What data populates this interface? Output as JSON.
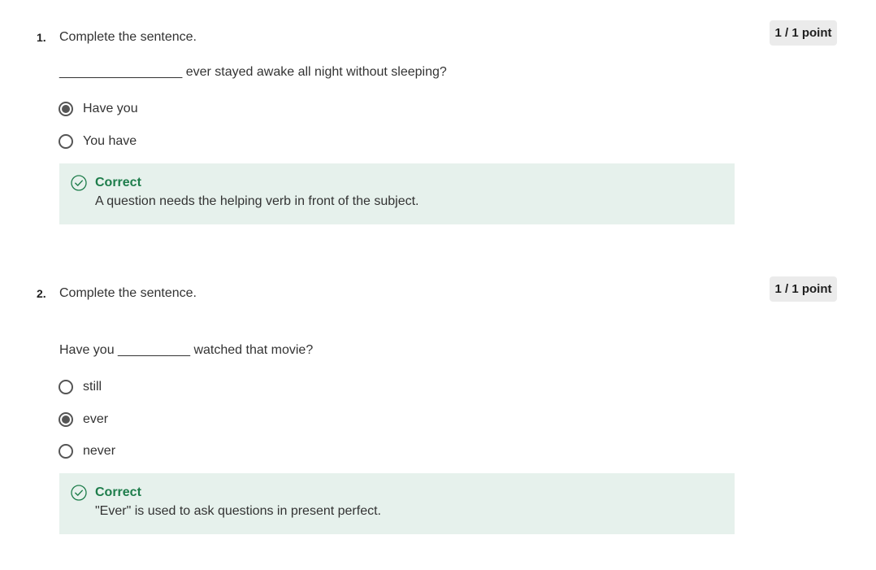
{
  "questions": [
    {
      "number": "1.",
      "prompt": "Complete the sentence.",
      "points": "1 / 1 point",
      "sentence": "_________________ ever stayed awake all night without sleeping?",
      "options": [
        {
          "label": "Have you",
          "selected": true
        },
        {
          "label": "You have",
          "selected": false
        }
      ],
      "feedback": {
        "status": "Correct",
        "icon": "check-circle-icon",
        "text": "A question needs the helping verb in front of the subject."
      }
    },
    {
      "number": "2.",
      "prompt": "Complete the sentence.",
      "points": "1 / 1 point",
      "sentence": "Have you __________ watched that movie?",
      "options": [
        {
          "label": "still",
          "selected": false
        },
        {
          "label": "ever",
          "selected": true
        },
        {
          "label": "never",
          "selected": false
        }
      ],
      "feedback": {
        "status": "Correct",
        "icon": "check-circle-icon",
        "text": "\"Ever\" is used to ask questions in present perfect."
      }
    }
  ],
  "colors": {
    "correct_green": "#1e7d4b",
    "feedback_bg": "#e6f1ec",
    "badge_bg": "#ebebeb"
  }
}
